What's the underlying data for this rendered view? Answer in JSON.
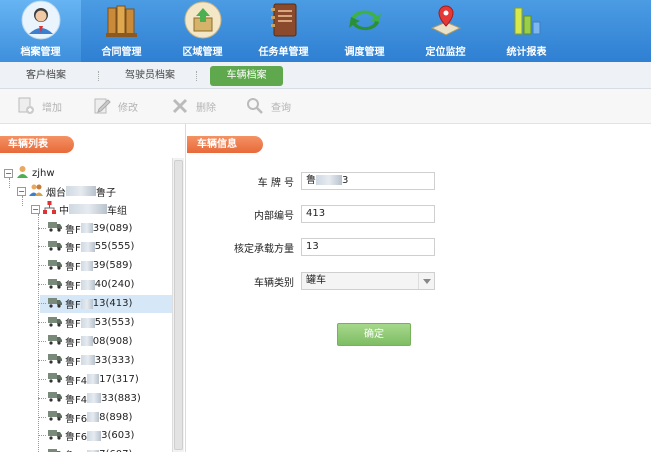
{
  "nav": {
    "items": [
      {
        "label": "档案管理",
        "icon": "user-icon"
      },
      {
        "label": "合同管理",
        "icon": "books-icon"
      },
      {
        "label": "区域管理",
        "icon": "upload-icon"
      },
      {
        "label": "任务单管理",
        "icon": "notebook-icon"
      },
      {
        "label": "调度管理",
        "icon": "refresh-icon"
      },
      {
        "label": "定位监控",
        "icon": "map-pin-icon"
      },
      {
        "label": "统计报表",
        "icon": "bar-chart-icon"
      }
    ],
    "active_index": 0,
    "accent": "#2f7fd3"
  },
  "subtabs": {
    "items": [
      "客户档案",
      "驾驶员档案",
      "车辆档案"
    ],
    "active_index": 2,
    "active_color": "#5fa84d"
  },
  "toolbar": {
    "add": "增加",
    "edit": "修改",
    "delete": "删除",
    "query": "查询"
  },
  "left": {
    "title": "车辆列表",
    "tree": {
      "root": "zjhw",
      "level1": {
        "prefix": "烟台",
        "suffix": "鲁子"
      },
      "level2": {
        "prefix": "中",
        "suffix": "车组"
      },
      "vehicles": [
        {
          "prefix": "鲁F",
          "suffix": "39(089)"
        },
        {
          "prefix": "鲁F",
          "suffix": "55(555)"
        },
        {
          "prefix": "鲁F",
          "suffix": "39(589)"
        },
        {
          "prefix": "鲁F",
          "suffix": "40(240)"
        },
        {
          "prefix": "鲁F",
          "suffix": "13(413)"
        },
        {
          "prefix": "鲁F",
          "suffix": "53(553)"
        },
        {
          "prefix": "鲁F",
          "suffix": "08(908)"
        },
        {
          "prefix": "鲁F",
          "suffix": "33(333)"
        },
        {
          "prefix": "鲁F4",
          "suffix": "17(317)"
        },
        {
          "prefix": "鲁F4",
          "suffix": "33(883)"
        },
        {
          "prefix": "鲁F6",
          "suffix": "8(898)"
        },
        {
          "prefix": "鲁F6",
          "suffix": "3(603)"
        },
        {
          "prefix": "鲁F6",
          "suffix": "7(607)"
        }
      ],
      "selected_index": 4
    }
  },
  "form": {
    "title": "车辆信息",
    "plate_label": "车 牌 号",
    "plate_prefix": "鲁",
    "plate_suffix": "3",
    "internal_label": "内部编号",
    "internal_value": "413",
    "capacity_label": "核定承载方量",
    "capacity_value": "13",
    "type_label": "车辆类别",
    "type_value": "罐车",
    "submit": "确定"
  }
}
